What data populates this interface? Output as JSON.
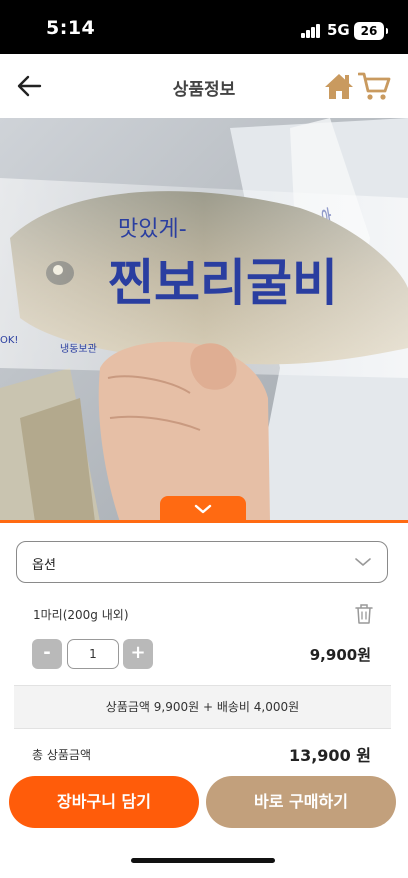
{
  "status_bar": {
    "time": "5:14",
    "network": "5G",
    "battery": "26"
  },
  "header": {
    "title": "상품정보"
  },
  "product": {
    "image_label": "product-photo",
    "package_text": "맛있게- 찐보리굴비",
    "accent_color": "#ff6a12"
  },
  "options": {
    "label": "옵션"
  },
  "selected_item": {
    "name": "1마리(200g 내외)",
    "quantity": "1",
    "price": "9,900원",
    "minus_label": "-",
    "plus_label": "+"
  },
  "summary": {
    "text": "상품금액 9,900원 + 배송비 4,000원"
  },
  "total": {
    "label": "총 상품금액",
    "price": "13,900 원"
  },
  "actions": {
    "add_to_cart": "장바구니 담기",
    "buy_now": "바로 구매하기",
    "cart_color": "#ff5c0a",
    "buy_color": "#c2a07c"
  }
}
